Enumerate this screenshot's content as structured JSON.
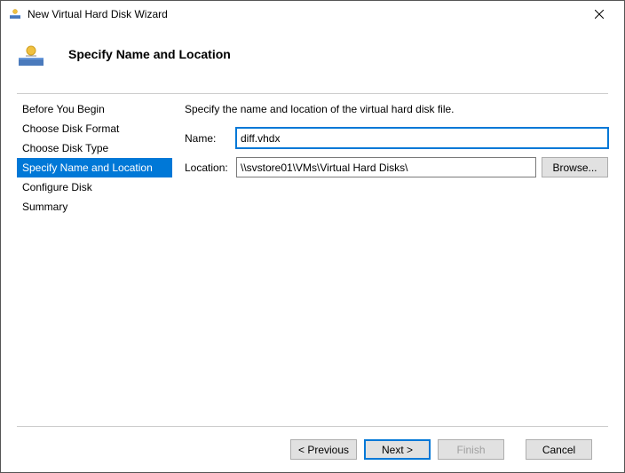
{
  "window": {
    "title": "New Virtual Hard Disk Wizard"
  },
  "header": {
    "title": "Specify Name and Location"
  },
  "sidebar": {
    "items": [
      {
        "label": "Before You Begin",
        "selected": false
      },
      {
        "label": "Choose Disk Format",
        "selected": false
      },
      {
        "label": "Choose Disk Type",
        "selected": false
      },
      {
        "label": "Specify Name and Location",
        "selected": true
      },
      {
        "label": "Configure Disk",
        "selected": false
      },
      {
        "label": "Summary",
        "selected": false
      }
    ]
  },
  "main": {
    "description": "Specify the name and location of the virtual hard disk file.",
    "name_label": "Name:",
    "name_value": "diff.vhdx",
    "location_label": "Location:",
    "location_value": "\\\\svstore01\\VMs\\Virtual Hard Disks\\",
    "browse_label": "Browse..."
  },
  "footer": {
    "previous": "< Previous",
    "next": "Next >",
    "finish": "Finish",
    "cancel": "Cancel"
  }
}
